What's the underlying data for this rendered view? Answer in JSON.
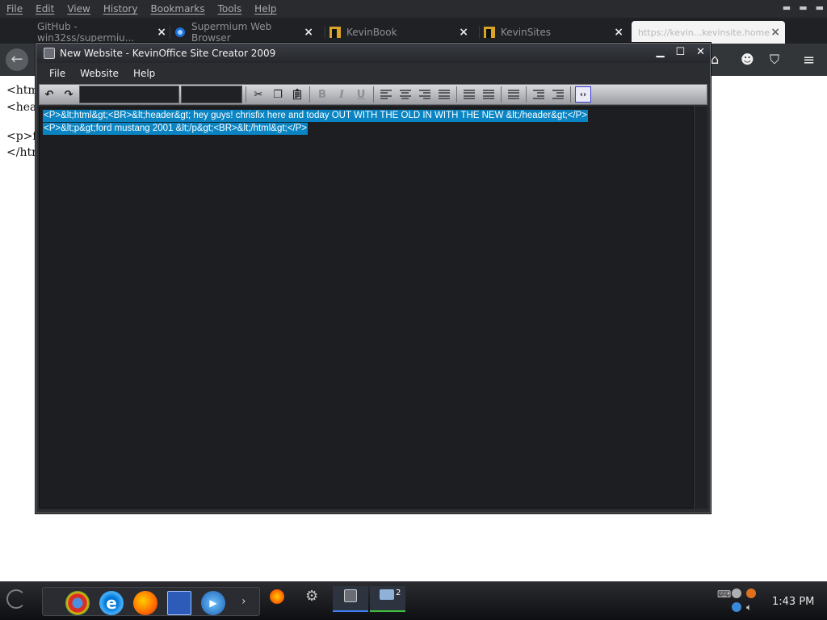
{
  "browser": {
    "menu": [
      "File",
      "Edit",
      "View",
      "History",
      "Bookmarks",
      "Tools",
      "Help"
    ],
    "tabs": [
      {
        "label": "GitHub - win32ss/supermiu...",
        "icon": "github-icon"
      },
      {
        "label": "Supermium Web Browser",
        "icon": "supermium-icon"
      },
      {
        "label": "KevinBook",
        "icon": "kevinbook-icon"
      },
      {
        "label": "KevinSites",
        "icon": "kevinsites-icon"
      },
      {
        "label": "https://kevin...kevinsite.home",
        "icon": "page-icon"
      }
    ],
    "page_lines": [
      "<html",
      "<head",
      "<p>fo",
      "</html"
    ]
  },
  "app": {
    "title": "New Website - KevinOffice Site Creator 2009",
    "menu": [
      "File",
      "Website",
      "Help"
    ],
    "editor_lines": [
      "<P>&lt;html&gt;<BR>&lt;header&gt; hey guys! chrisfix here and today OUT WITH THE OLD IN WITH THE NEW &lt;/header&gt;</P>",
      "<P>&lt;p&gt;ford mustang 2001 &lt;/p&gt;<BR>&lt;/html&gt;</P>"
    ]
  },
  "taskbar": {
    "clock": "1:43 PM",
    "folder_count": "2"
  },
  "colors": {
    "selection": "#0a84c2",
    "editor_bg": "#1d1e22",
    "window_bg": "#2b2d31"
  }
}
